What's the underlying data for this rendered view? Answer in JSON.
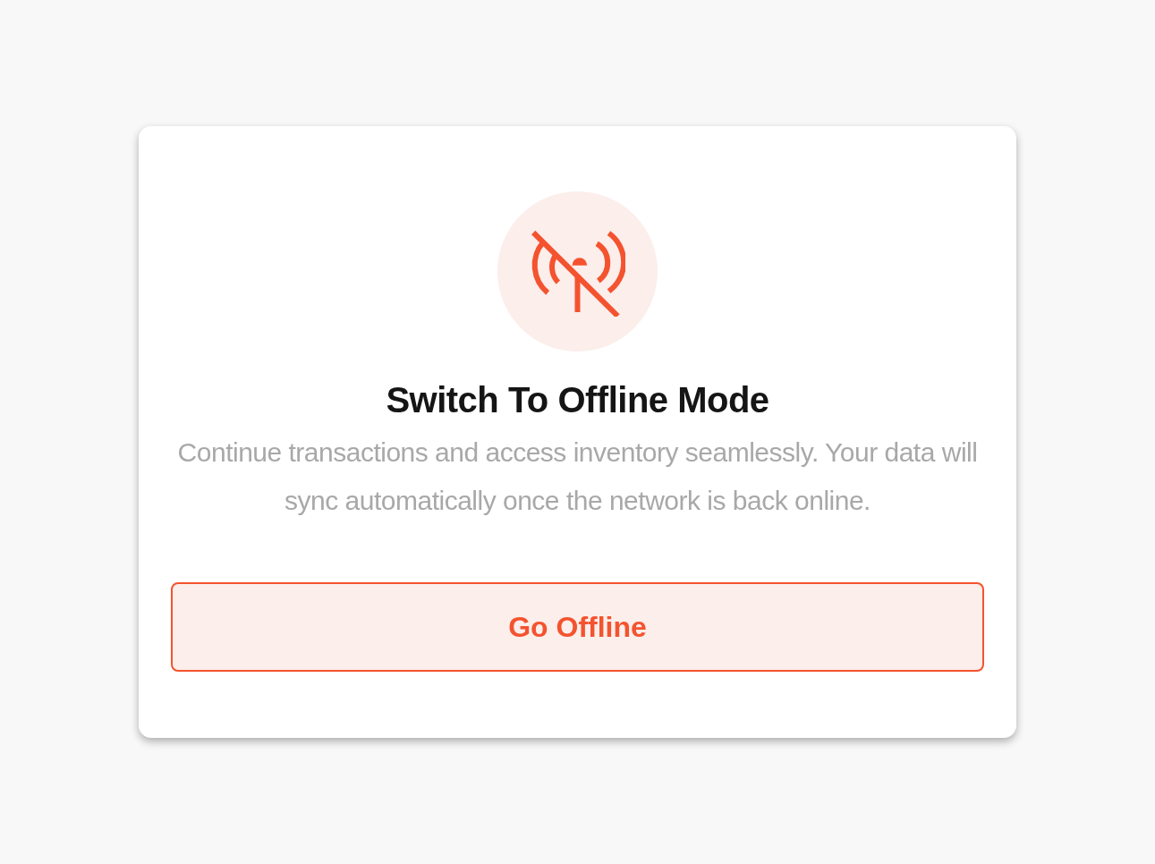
{
  "dialog": {
    "title": "Switch To Offline Mode",
    "message": "Continue transactions and access inventory seamlessly. Your data will sync automatically once the network is back online.",
    "button": "Go Offline"
  }
}
